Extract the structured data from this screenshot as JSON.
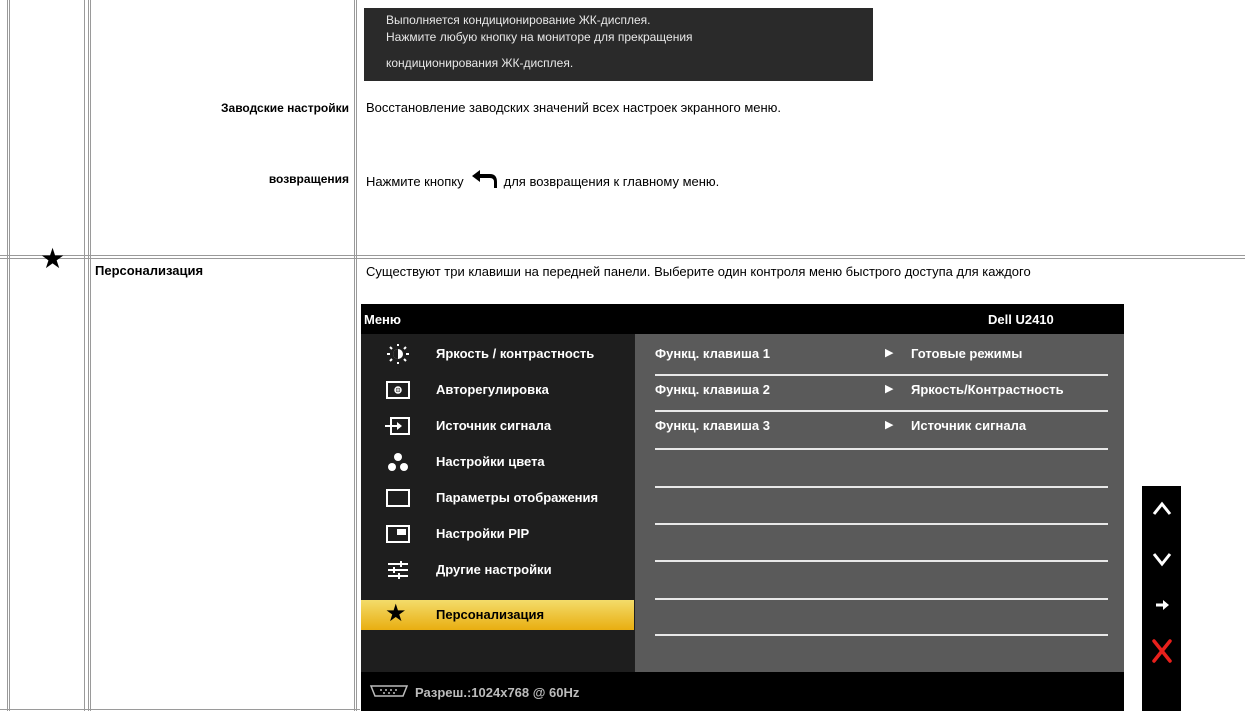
{
  "conditioning_notice": {
    "line1": "Выполняется кондиционирование ЖК-дисплея.",
    "line2": "Нажмите любую кнопку на мониторе  для прекращения",
    "line3": "кондиционирования ЖК-дисплея."
  },
  "rows": {
    "factory_reset": {
      "label": "Заводские настройки",
      "description": "Восстановление заводских значений всех настроек экранного меню."
    },
    "return": {
      "label": "возвращения",
      "description_before": "Нажмите кнопку",
      "description_after": "для возвращения к главному меню."
    },
    "personalize": {
      "icon": "star-icon",
      "label": "Персонализация",
      "description": "Существуют три клавиши на передней панели. Выберите один контроля меню быстрого доступа для каждого"
    }
  },
  "osd": {
    "title": "Меню",
    "model": "Dell U2410",
    "menu_items": [
      {
        "icon": "brightness-icon",
        "label": "Яркость / контрастность"
      },
      {
        "icon": "auto-adjust-icon",
        "label": "Авторегулировка"
      },
      {
        "icon": "input-source-icon",
        "label": "Источник сигнала"
      },
      {
        "icon": "color-settings-icon",
        "label": "Настройки цвета"
      },
      {
        "icon": "display-settings-icon",
        "label": "Параметры отображения"
      },
      {
        "icon": "pip-settings-icon",
        "label": "Настройки PIP"
      },
      {
        "icon": "other-settings-icon",
        "label": "Другие настройки"
      },
      {
        "icon": "star-icon",
        "label": "Персонализация",
        "selected": true
      }
    ],
    "shortcut_rows": [
      {
        "key": "Функц. клавиша 1",
        "value": "Готовые режимы"
      },
      {
        "key": "Функц. клавиша 2",
        "value": "Яркость/Контрастность"
      },
      {
        "key": "Функц. клавиша 3",
        "value": "Источник сигнала"
      }
    ],
    "footer": "Разреш.:1024x768 @ 60Hz",
    "footer_icon": "vga-connector-icon",
    "highlight_color": "#e9ae10"
  },
  "nav_buttons": [
    {
      "icon": "up-arrow-icon",
      "symbol": "∧"
    },
    {
      "icon": "down-arrow-icon",
      "symbol": "∨"
    },
    {
      "icon": "right-arrow-icon",
      "symbol": "→"
    },
    {
      "icon": "exit-icon",
      "symbol": "✕"
    }
  ]
}
